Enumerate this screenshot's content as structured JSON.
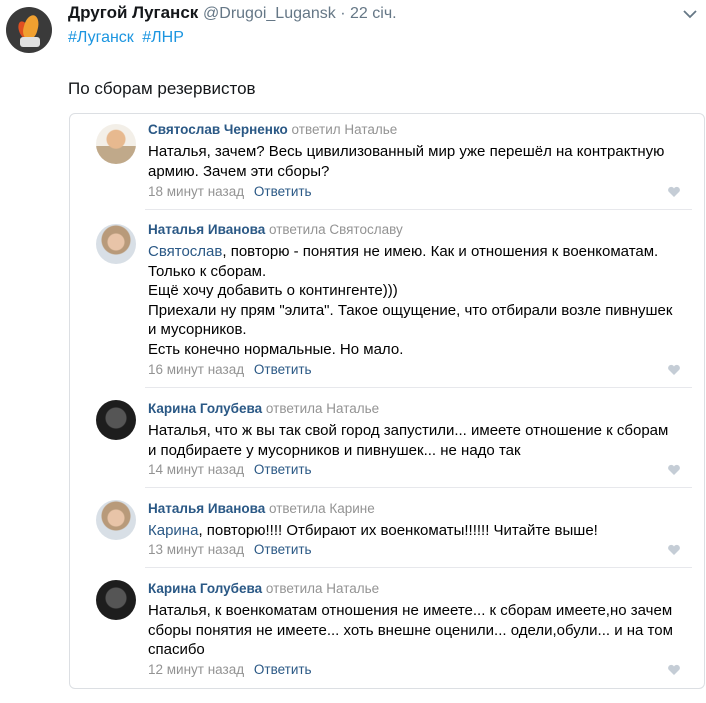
{
  "tweet": {
    "display_name": "Другой Луганск",
    "handle": "@Drugoi_Lugansk · 22 січ.",
    "hashtags": [
      "#Луганск",
      "#ЛНР"
    ],
    "text": "По сборам резервистов"
  },
  "comments": [
    {
      "author": "Святослав Черненко",
      "action": "ответил Наталье",
      "lines": [
        "Наталья, зачем? Весь цивилизованный мир уже перешёл на контрактную",
        "армию. Зачем эти сборы?"
      ],
      "time": "18 минут назад",
      "reply": "Ответить"
    },
    {
      "author": "Наталья Иванова",
      "action": "ответила Святославу",
      "mention": "Святослав",
      "first_rest": ", повторю - понятия не имею. Как и отношения к военкоматам.",
      "lines": [
        "Только к сборам.",
        "Ещё хочу добавить о контингенте)))",
        "Приехали ну прям \"элита\". Такое ощущение, что отбирали возле пивнушек",
        "и мусорников.",
        "Есть конечно нормальные. Но мало."
      ],
      "time": "16 минут назад",
      "reply": "Ответить"
    },
    {
      "author": "Карина Голубева",
      "action": "ответила Наталье",
      "lines": [
        "Наталья, что ж вы так свой город запустили... имеете отношение к сборам",
        "и подбираете у мусорников и пивнушек... не надо так"
      ],
      "time": "14 минут назад",
      "reply": "Ответить"
    },
    {
      "author": "Наталья Иванова",
      "action": "ответила Карине",
      "mention": "Карина",
      "first_rest": ", повторю!!!! Отбирают их военкоматы!!!!!! Читайте выше!",
      "lines": [],
      "time": "13 минут назад",
      "reply": "Ответить"
    },
    {
      "author": "Карина Голубева",
      "action": "ответила Наталье",
      "lines": [
        "Наталья, к военкоматам отношения не имеете... к сборам имеете,но зачем",
        "сборы понятия не имеете... хоть внешне оценили... одели,обули... и на том",
        "спасибо"
      ],
      "time": "12 минут назад",
      "reply": "Ответить"
    }
  ],
  "colors": {
    "link": "#1b95e0",
    "vk_link": "#2a5885",
    "muted": "#939393"
  },
  "icons": [
    "chevron-down-icon",
    "like-heart-icon"
  ]
}
